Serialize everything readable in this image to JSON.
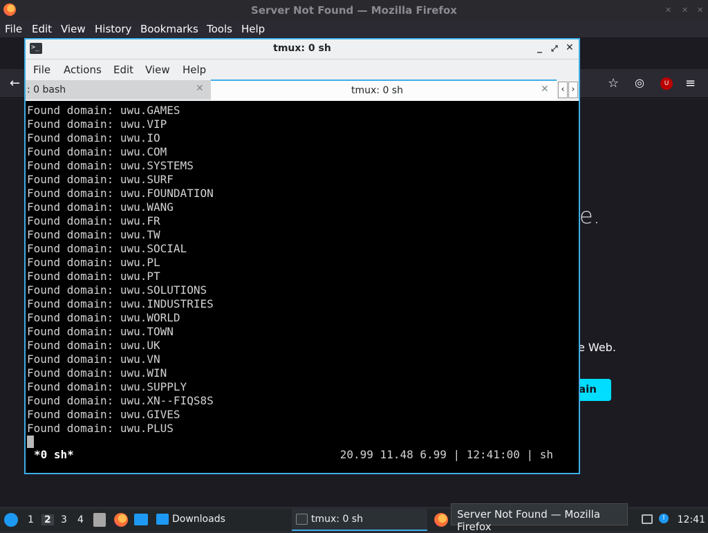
{
  "firefox": {
    "title": "Server Not Found — Mozilla Firefox",
    "menu": [
      "File",
      "Edit",
      "View",
      "History",
      "Bookmarks",
      "Tools",
      "Help"
    ],
    "content": {
      "fragment_e": "e.",
      "fragment_web": "e Web.",
      "button_fragment": "ain"
    }
  },
  "tmux_window": {
    "title": "tmux: 0 sh",
    "menu": [
      "File",
      "Actions",
      "Edit",
      "View",
      "Help"
    ],
    "tabs": [
      {
        "label": ": 0 bash",
        "active": false
      },
      {
        "label": "tmux: 0 sh",
        "active": true
      }
    ],
    "terminal_lines": [
      "Found domain: uwu.GAMES",
      "Found domain: uwu.VIP",
      "Found domain: uwu.IO",
      "Found domain: uwu.COM",
      "Found domain: uwu.SYSTEMS",
      "Found domain: uwu.SURF",
      "Found domain: uwu.FOUNDATION",
      "Found domain: uwu.WANG",
      "Found domain: uwu.FR",
      "Found domain: uwu.TW",
      "Found domain: uwu.SOCIAL",
      "Found domain: uwu.PL",
      "Found domain: uwu.PT",
      "Found domain: uwu.SOLUTIONS",
      "Found domain: uwu.INDUSTRIES",
      "Found domain: uwu.WORLD",
      "Found domain: uwu.TOWN",
      "Found domain: uwu.UK",
      "Found domain: uwu.VN",
      "Found domain: uwu.WIN",
      "Found domain: uwu.SUPPLY",
      "Found domain: uwu.XN--FIQS8S",
      "Found domain: uwu.GIVES",
      "Found domain: uwu.PLUS"
    ],
    "status": {
      "window": "*0 sh*",
      "right": "20.99 11.48 6.99 | 12:41:00 | sh"
    }
  },
  "taskbar": {
    "workspaces": [
      "1",
      "2",
      "3",
      "4"
    ],
    "active_workspace": "2",
    "downloads_label": "Downloads",
    "tmux_label": "tmux: 0 sh",
    "tooltip": "Server Not Found — Mozilla Firefox",
    "clock": "12:41"
  },
  "colors": {
    "accent": "#3daee9",
    "firefox_bg": "#1c1b22",
    "terminal_bg": "#000000",
    "try_button": "#00ddff"
  }
}
